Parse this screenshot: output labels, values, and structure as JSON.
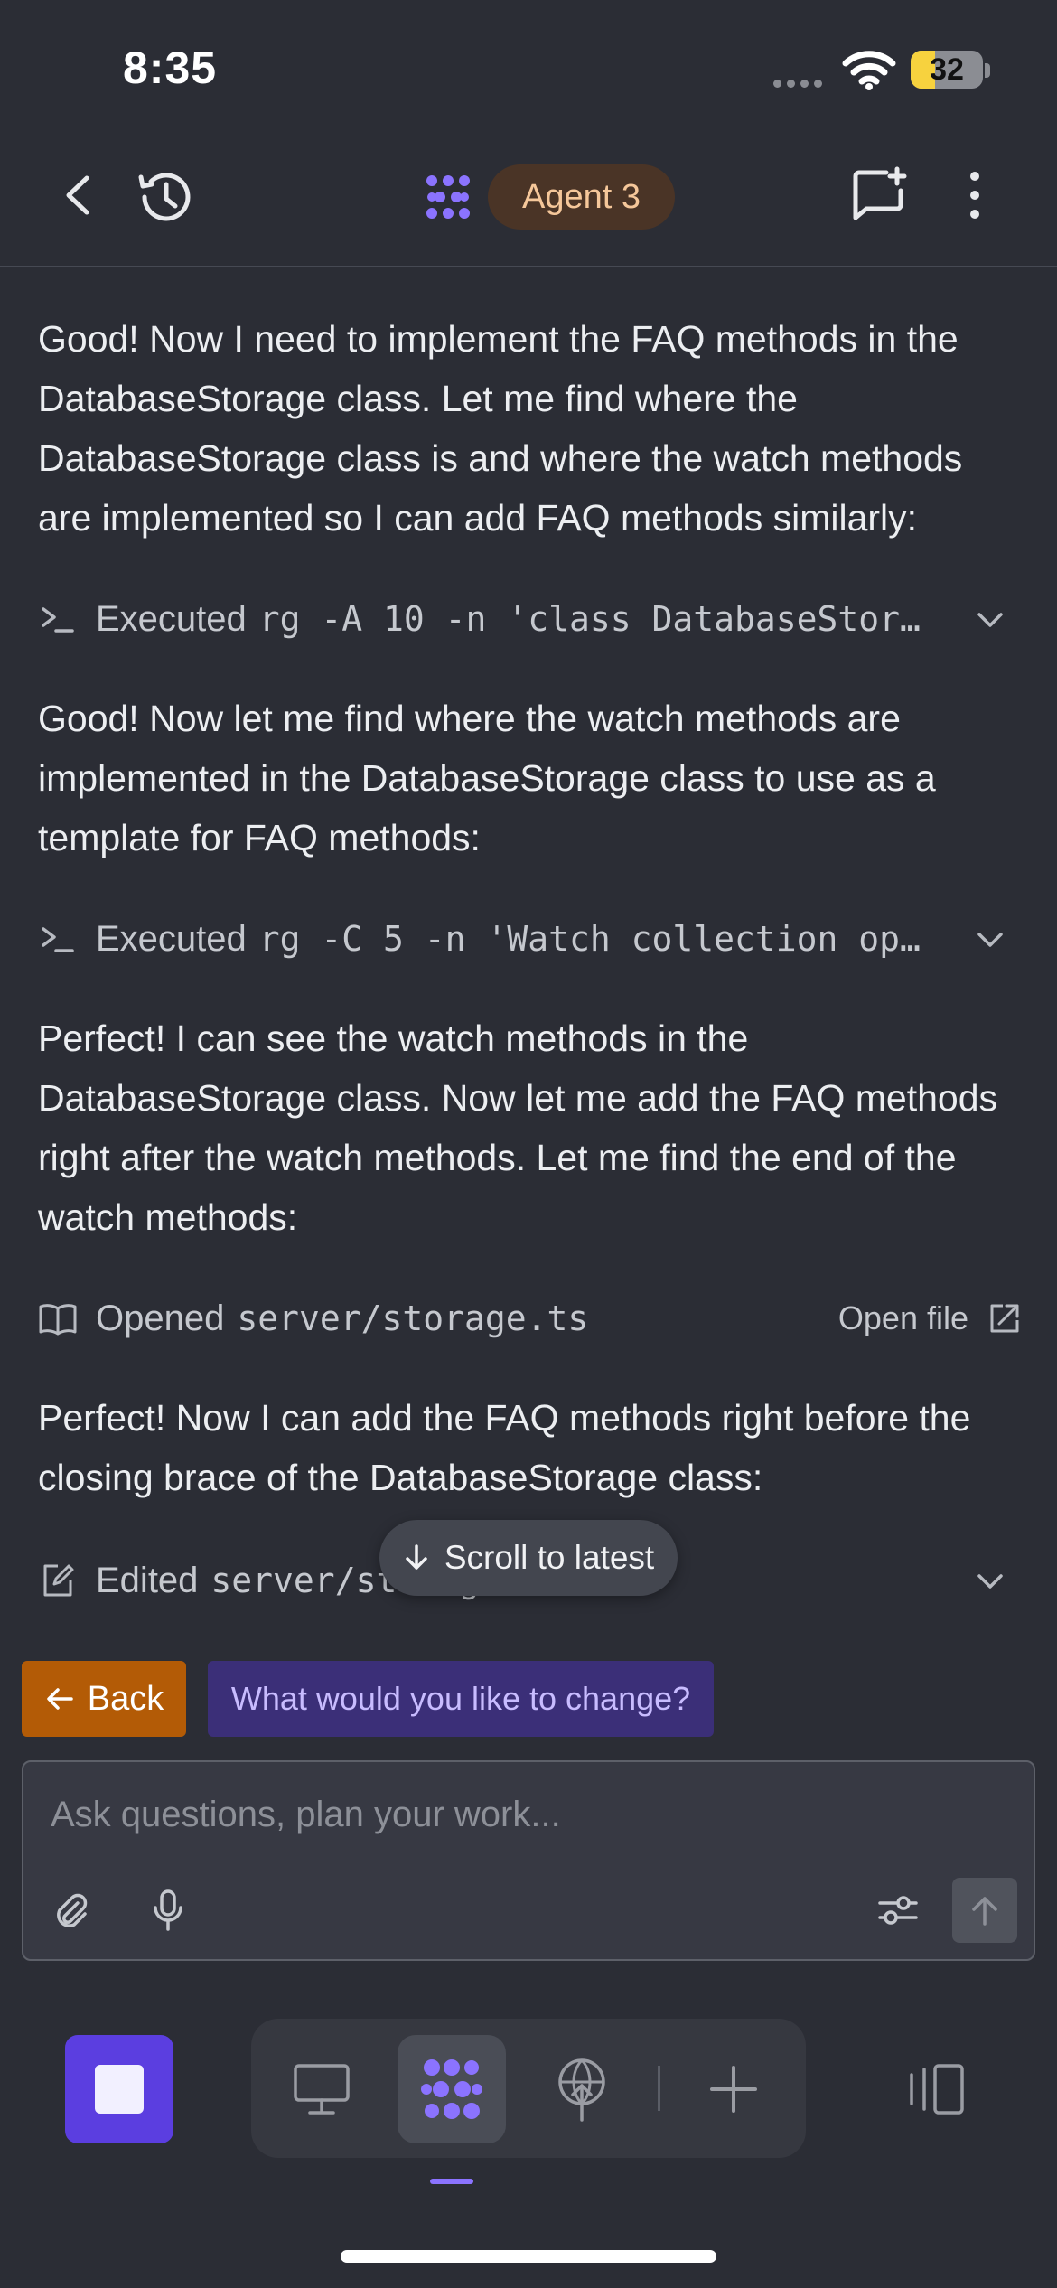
{
  "status_bar": {
    "time": "8:35",
    "battery": "32"
  },
  "header": {
    "agent_label": "Agent 3"
  },
  "chat": {
    "messages": [
      "Good! Now I need to implement the FAQ methods in the DatabaseStorage class. Let me find where the DatabaseStorage class is and where the watch methods are implemented so I can add FAQ methods similarly:",
      "Good! Now let me find where the watch methods are implemented in the DatabaseStorage class to use as a template for FAQ methods:",
      "Perfect! I can see the watch methods in the DatabaseStorage class. Now let me add the FAQ methods right after the watch methods. Let me find the end of the watch methods:",
      "Perfect! Now I can add the FAQ methods right before the closing brace of the DatabaseStorage class:"
    ],
    "actions": [
      {
        "verb": "Executed",
        "detail": "rg -A 10 -n 'class DatabaseStor…",
        "icon": "terminal-icon"
      },
      {
        "verb": "Executed",
        "detail": "rg -C 5 -n 'Watch collection op…",
        "icon": "terminal-icon"
      },
      {
        "verb": "Opened",
        "detail": "server/storage.ts",
        "icon": "book-icon",
        "link": "Open file"
      },
      {
        "verb": "Edited",
        "detail": "server/storage.ts",
        "icon": "edit-icon"
      }
    ],
    "scroll_to_latest": "Scroll to latest"
  },
  "suggestions": {
    "back": "Back",
    "change": "What would you like to change?"
  },
  "input": {
    "placeholder": "Ask questions, plan your work..."
  },
  "colors": {
    "background": "#2b2d35",
    "accent": "#5b3ee0",
    "back_button": "#b35b06",
    "agent_pill": "#4a3426"
  }
}
